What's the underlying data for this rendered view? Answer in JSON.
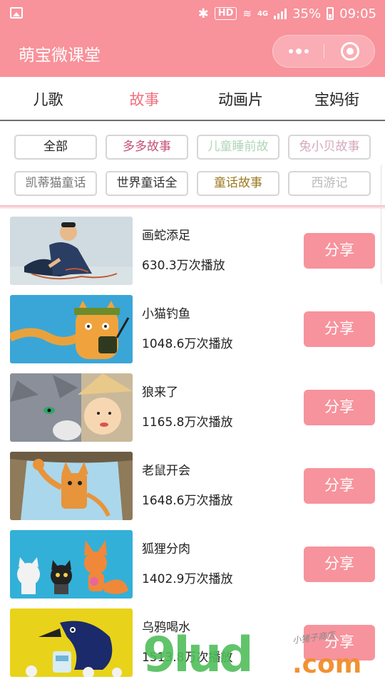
{
  "status_bar": {
    "hd": "HD",
    "network": "4G",
    "battery": "35%",
    "time": "09:05",
    "battery_level": 0.35
  },
  "header": {
    "title": "萌宝微课堂",
    "more_icon": "more-dots-icon",
    "close_icon": "target-close-icon"
  },
  "tabs": [
    {
      "label": "儿歌",
      "active": false
    },
    {
      "label": "故事",
      "active": true
    },
    {
      "label": "动画片",
      "active": false
    },
    {
      "label": "宝妈街",
      "active": false
    }
  ],
  "filters": [
    {
      "label": "全部",
      "color": "#222222"
    },
    {
      "label": "多多故事",
      "color": "#c3507a"
    },
    {
      "label": "儿童睡前故",
      "color": "#b0d6b8"
    },
    {
      "label": "兔小贝故事",
      "color": "#d5a8bd"
    },
    {
      "label": "凯蒂猫童话",
      "color": "#777777"
    },
    {
      "label": "世界童话全",
      "color": "#333333"
    },
    {
      "label": "童话故事",
      "color": "#9b7a1f"
    },
    {
      "label": "西游记",
      "color": "#bbbbbb"
    }
  ],
  "stories": [
    {
      "title": "画蛇添足",
      "plays": "630.3万次播放",
      "share": "分享"
    },
    {
      "title": "小猫钓鱼",
      "plays": "1048.6万次播放",
      "share": "分享"
    },
    {
      "title": "狼来了",
      "plays": "1165.8万次播放",
      "share": "分享"
    },
    {
      "title": "老鼠开会",
      "plays": "1648.6万次播放",
      "share": "分享"
    },
    {
      "title": "狐狸分肉",
      "plays": "1402.9万次播放",
      "share": "分享"
    },
    {
      "title": "乌鸦喝水",
      "plays": "1513.8万次播放",
      "share": "分享"
    }
  ],
  "watermark": {
    "text_main": "9lud",
    "text_domain": ".com",
    "text_hand": "小猪子商店"
  },
  "colors": {
    "brand": "#f8929b",
    "tab_active": "#f0707d",
    "share_button": "#f7939c"
  }
}
